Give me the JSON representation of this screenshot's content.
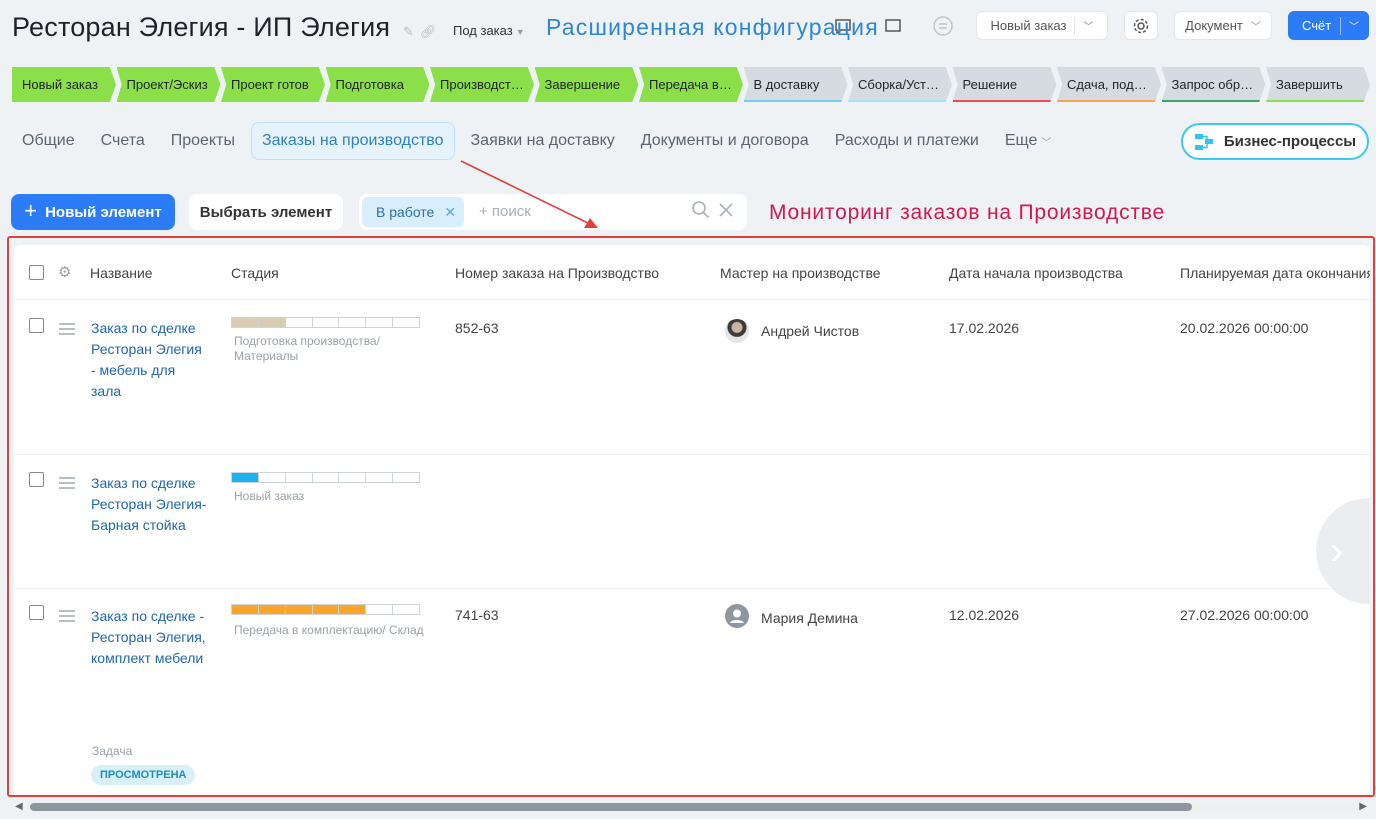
{
  "header": {
    "title": "Ресторан Элегия - ИП Элегия",
    "order_type": "Под заказ",
    "overlay_caption": "Расширенная конфигурация",
    "new_order_label": "Новый заказ",
    "document_label": "Документ",
    "invoice_label": "Счёт"
  },
  "stages": [
    {
      "label": "Новый заказ",
      "bg": "#8be04a",
      "underline": ""
    },
    {
      "label": "Проект/Эскиз",
      "bg": "#8be04a",
      "underline": ""
    },
    {
      "label": "Проект готов",
      "bg": "#8be04a",
      "underline": ""
    },
    {
      "label": "Подготовка",
      "bg": "#8be04a",
      "underline": ""
    },
    {
      "label": "Производство",
      "bg": "#8be04a",
      "underline": ""
    },
    {
      "label": "Завершение",
      "bg": "#8be04a",
      "underline": ""
    },
    {
      "label": "Передача в комплектацию",
      "bg": "#8be04a",
      "underline": ""
    },
    {
      "label": "В доставку",
      "bg": "#d5dbe0",
      "underline": "#74d0f0"
    },
    {
      "label": "Сборка/Установка",
      "bg": "#d5dbe0",
      "underline": "#a8dff2"
    },
    {
      "label": "Решение",
      "bg": "#d5dbe0",
      "underline": "#ec4d55"
    },
    {
      "label": "Сдача, подписание",
      "bg": "#d5dbe0",
      "underline": "#f5a64b"
    },
    {
      "label": "Запрос обратной связи",
      "bg": "#d5dbe0",
      "underline": "#39a86b"
    },
    {
      "label": "Завершить",
      "bg": "#d5dbe0",
      "underline": "#8be04a"
    }
  ],
  "tabs": [
    {
      "label": "Общие",
      "active": false
    },
    {
      "label": "Счета",
      "active": false
    },
    {
      "label": "Проекты",
      "active": false
    },
    {
      "label": "Заказы на производство",
      "active": true
    },
    {
      "label": "Заявки на доставку",
      "active": false
    },
    {
      "label": "Документы и договора",
      "active": false
    },
    {
      "label": "Расходы и платежи",
      "active": false
    },
    {
      "label": "Еще",
      "active": false,
      "dropdown": true
    }
  ],
  "business_processes_label": "Бизнес-процессы",
  "toolbar": {
    "new_element_label": "Новый элемент",
    "select_element_label": "Выбрать элемент",
    "filter_chip": "В работе",
    "search_placeholder": "+ поиск"
  },
  "overlay_monitoring": "Мониторинг заказов на Производстве",
  "table": {
    "columns": [
      "Название",
      "Стадия",
      "Номер заказа на Производство",
      "Мастер на производстве",
      "Дата начала производства",
      "Планируемая дата окончания"
    ],
    "rows": [
      {
        "name": "Заказ по сделке Ресторан Элегия - мебель для зала",
        "stage_label": "Подготовка производства/ Материалы",
        "stage_progress_segments": 2,
        "stage_total_segments": 7,
        "stage_color": "#d9ceb5",
        "order_number": "852-63",
        "master": "Андрей Чистов",
        "master_avatar": "photo",
        "start_date": "17.02.2026",
        "planned_end": "20.02.2026 00:00:00"
      },
      {
        "name": "Заказ по сделке Ресторан Элегия- Барная стойка",
        "stage_label": "Новый заказ",
        "stage_progress_segments": 1,
        "stage_total_segments": 7,
        "stage_color": "#1fb0ee",
        "order_number": "",
        "master": "",
        "start_date": "",
        "planned_end": ""
      },
      {
        "name": "Заказ по сделке - Ресторан Элегия, комплект мебели",
        "stage_label": "Передача в комплектацию/ Склад",
        "stage_progress_segments": 5,
        "stage_total_segments": 7,
        "stage_color": "#f9a42b",
        "order_number": "741-63",
        "master": "Мария Демина",
        "master_avatar": "placeholder-user-icon",
        "start_date": "12.02.2026",
        "planned_end": "27.02.2026 00:00:00",
        "sub_label": "Задача",
        "badge": "ПРОСМОТРЕНА"
      }
    ]
  }
}
